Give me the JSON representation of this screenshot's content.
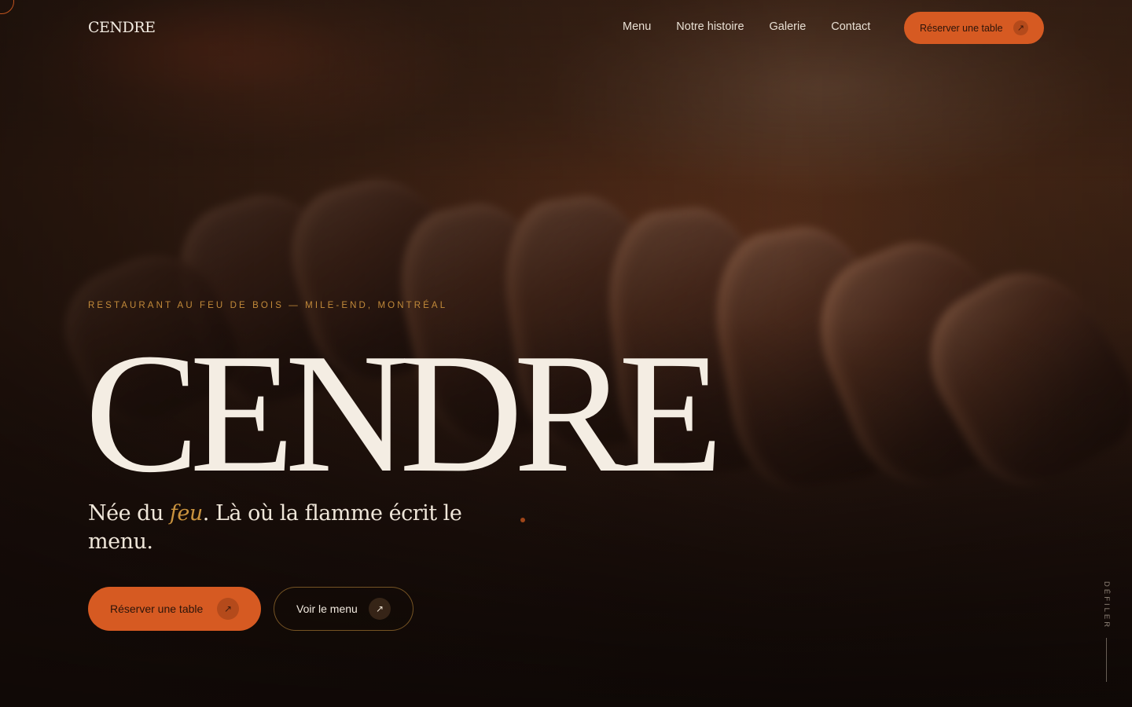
{
  "header": {
    "logo": "CENDRE",
    "nav": [
      "Menu",
      "Notre histoire",
      "Galerie",
      "Contact"
    ],
    "cta_label": "Réserver une table",
    "cta_icon": "arrow-up-right-icon"
  },
  "hero": {
    "eyebrow": "RESTAURANT AU FEU DE BOIS — MILE-END, MONTRÉAL",
    "title": "CENDRE",
    "tagline_before": "Née du ",
    "tagline_accent": "feu",
    "tagline_after": ". Là où la flamme écrit le menu.",
    "primary_cta": "Réserver une table",
    "secondary_cta": "Voir le menu"
  },
  "scroll": {
    "label": "DÉFILER"
  },
  "colors": {
    "accent": "#d65a22",
    "gold": "#c9923e",
    "background": "#1a0f0a",
    "text": "#f3ece2"
  }
}
